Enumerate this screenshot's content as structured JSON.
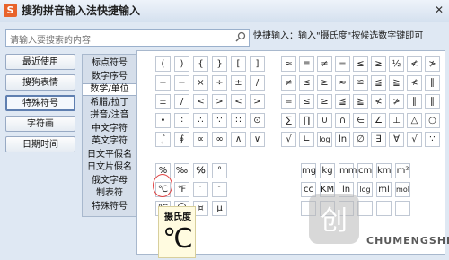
{
  "window": {
    "title": "搜狗拼音输入法快捷输入",
    "logo_glyph": "S",
    "close_glyph": "✕"
  },
  "search": {
    "placeholder": "请输入要搜索的内容"
  },
  "hint": "快捷输入：输入\"摄氏度\"按候选数字键即可",
  "left_buttons": [
    "最近使用",
    "搜狗表情",
    "特殊符号",
    "字符画",
    "日期时间"
  ],
  "left_active": "特殊符号",
  "categories": [
    "标点符号",
    "数字序号",
    "数学/单位",
    "希腊/拉丁",
    "拼音/注音",
    "中文字符",
    "英文字符",
    "日文平假名",
    "日文片假名",
    "俄文字母",
    "制表符",
    "特殊符号"
  ],
  "selected_category": "数学/单位",
  "grid_left": [
    [
      "(",
      ")",
      "{",
      "}",
      "[",
      "]"
    ],
    [
      "+",
      "−",
      "×",
      "÷",
      "±",
      "/"
    ],
    [
      "±",
      "/",
      "<",
      ">",
      "<",
      ">"
    ],
    [
      "•",
      "∶",
      "∴",
      "∵",
      "∷",
      "⊙"
    ],
    [
      "∫",
      "∮",
      "∝",
      "∞",
      "∧",
      "∨"
    ]
  ],
  "grid_right": [
    [
      "≈",
      "≡",
      "≠",
      "=",
      "≤",
      "≥",
      "½",
      "≮",
      "≯"
    ],
    [
      "≠",
      "≤",
      "≥",
      "≈",
      "≌",
      "≦",
      "≧",
      "≮",
      "∥"
    ],
    [
      "=",
      "≤",
      "≥",
      "≦",
      "≧",
      "≮",
      "≯",
      "∥",
      "∥"
    ],
    [
      "∑",
      "∏",
      "∪",
      "∩",
      "∈",
      "∠",
      "⊥",
      "△",
      "○"
    ],
    [
      "√",
      "∟",
      "log",
      "ln",
      "∅",
      "∃",
      "∀",
      "√",
      "∵"
    ]
  ],
  "grid_units_left": [
    [
      "%",
      "‰",
      "℅",
      "°"
    ],
    [
      "℃",
      "℉",
      "′",
      "″"
    ],
    [
      "℃",
      "〇",
      "¤",
      "μ"
    ]
  ],
  "grid_units_right": [
    [
      "mg",
      "kg",
      "mm",
      "cm",
      "km",
      "m²"
    ],
    [
      "cc",
      "KM",
      "ln",
      "log",
      "ml",
      "mol"
    ],
    [
      "",
      "",
      "",
      "",
      "",
      ""
    ]
  ],
  "tooltip": {
    "label": "摄氏度",
    "glyph": "℃"
  },
  "watermark": {
    "logo": "创",
    "text": "CHUMENGSHI"
  },
  "colors": {
    "accent": "#e8632b",
    "highlight": "#e04040"
  }
}
